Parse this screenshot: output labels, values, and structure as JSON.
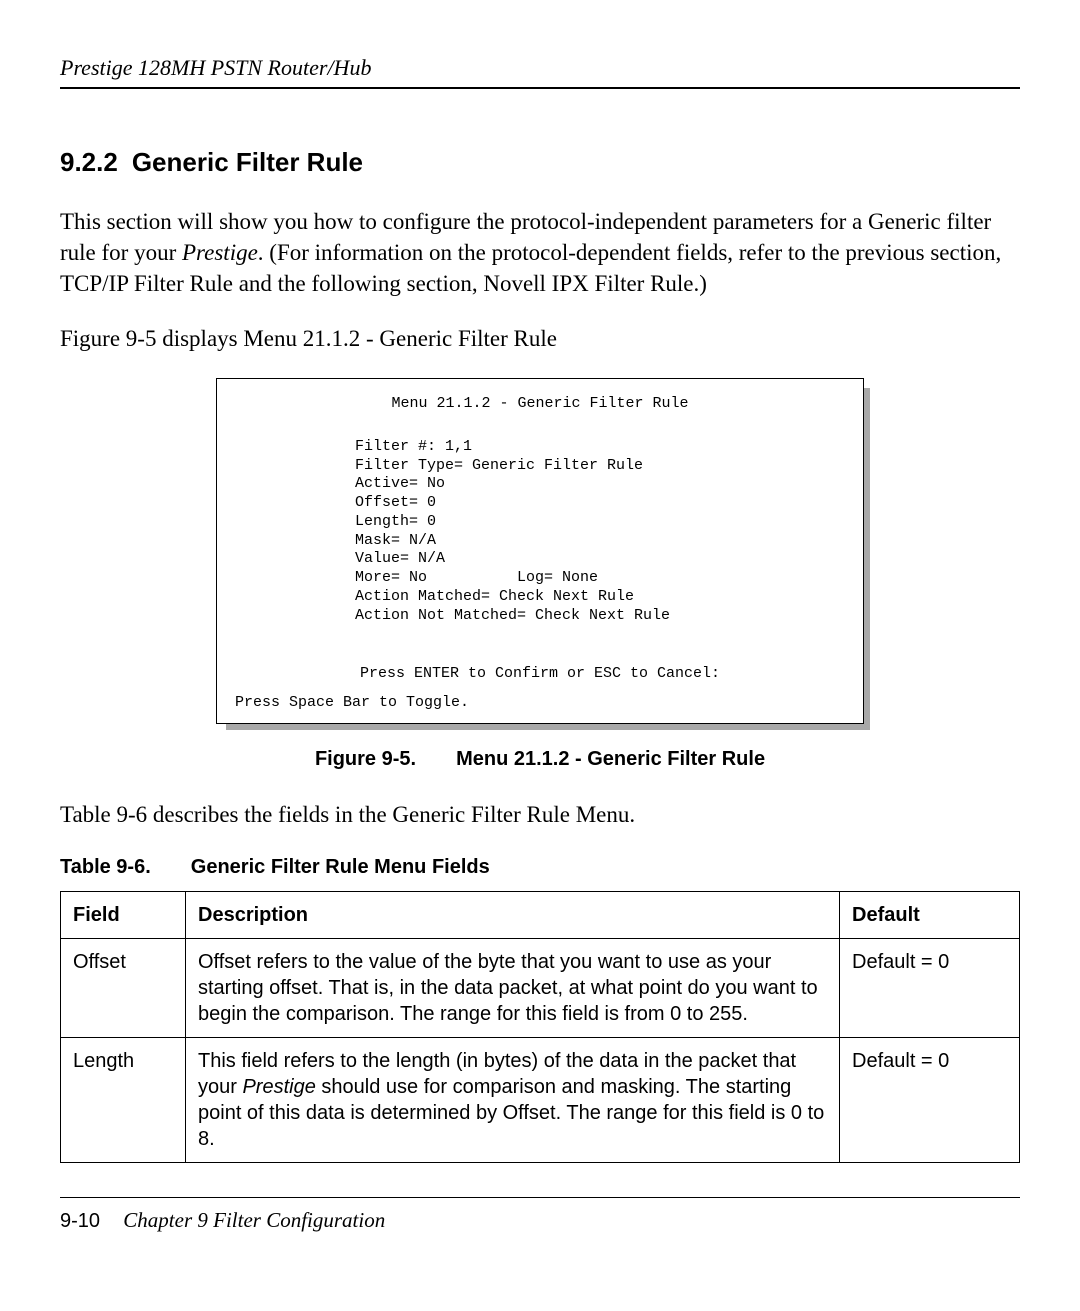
{
  "running_header": "Prestige 128MH    PSTN Router/Hub",
  "section": {
    "number": "9.2.2",
    "title": "Generic Filter Rule"
  },
  "para1_before_italic": "This section will show you how to configure the protocol-independent parameters for a Generic filter rule for your ",
  "para1_italic": "Prestige",
  "para1_after_italic": ". (For information on the protocol-dependent fields, refer to the previous section, TCP/IP Filter Rule and the following section, Novell IPX Filter Rule.)",
  "para2": "Figure 9-5 displays Menu 21.1.2 - Generic Filter Rule",
  "figure": {
    "menu_title": "Menu 21.1.2 - Generic Filter Rule",
    "fields": {
      "filter_no": "Filter #: 1,1",
      "filter_type": "Filter Type= Generic Filter Rule",
      "active": "Active= No",
      "offset": "Offset= 0",
      "length": "Length= 0",
      "mask": "Mask= N/A",
      "value": "Value= N/A",
      "more_log": "More= No          Log= None",
      "action_m": "Action Matched= Check Next Rule",
      "action_nm": "Action Not Matched= Check Next Rule"
    },
    "confirm": "Press ENTER to Confirm or ESC to Cancel:",
    "spacebar": "Press Space Bar to Toggle."
  },
  "figure_caption": {
    "label": "Figure 9-5.",
    "text": "Menu 21.1.2 - Generic Filter Rule"
  },
  "para3": "Table 9-6 describes the fields in the Generic Filter Rule Menu.",
  "table_caption": {
    "label": "Table 9-6.",
    "text": "Generic Filter Rule Menu Fields"
  },
  "table": {
    "headers": {
      "field": "Field",
      "description": "Description",
      "default": "Default"
    },
    "rows": [
      {
        "field": "Offset",
        "desc_prefix": "Offset refers to the value of the byte that you want to use as your starting offset. That is, in the data packet, at what point do you want to begin the comparison. The range for this field is from 0 to 255.",
        "desc_italic": "",
        "desc_suffix": "",
        "default": "Default = 0"
      },
      {
        "field": "Length",
        "desc_prefix": "This field refers to the length (in bytes) of the data in the packet that your ",
        "desc_italic": "Prestige",
        "desc_suffix": " should use for comparison and masking. The starting point of this data is determined by Offset. The range for this field is 0 to 8.",
        "default": "Default = 0"
      }
    ]
  },
  "footer": {
    "pagenum": "9-10",
    "chapter": "Chapter 9 Filter Configuration"
  }
}
